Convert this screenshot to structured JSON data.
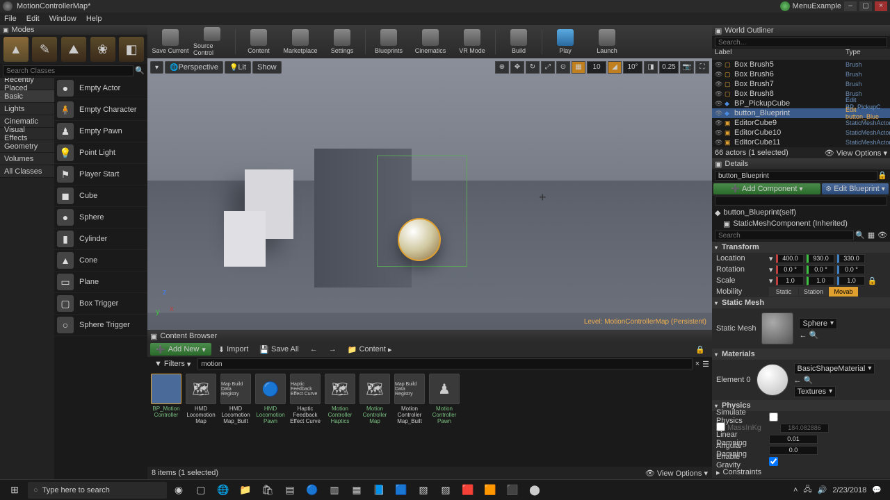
{
  "title": "MotionControllerMap*",
  "menu_example": "MenuExample",
  "menubar": [
    "File",
    "Edit",
    "Window",
    "Help"
  ],
  "modes": {
    "label": "Modes"
  },
  "search_classes_placeholder": "Search Classes",
  "categories": [
    "Recently Placed",
    "Basic",
    "Lights",
    "Cinematic",
    "Visual Effects",
    "Geometry",
    "Volumes",
    "All Classes"
  ],
  "place_items": [
    "Empty Actor",
    "Empty Character",
    "Empty Pawn",
    "Point Light",
    "Player Start",
    "Cube",
    "Sphere",
    "Cylinder",
    "Cone",
    "Plane",
    "Box Trigger",
    "Sphere Trigger"
  ],
  "toolbar": [
    {
      "id": "save",
      "label": "Save Current"
    },
    {
      "id": "source",
      "label": "Source Control"
    },
    {
      "id": "content",
      "label": "Content"
    },
    {
      "id": "market",
      "label": "Marketplace"
    },
    {
      "id": "settings",
      "label": "Settings"
    },
    {
      "id": "blueprints",
      "label": "Blueprints"
    },
    {
      "id": "cinematics",
      "label": "Cinematics"
    },
    {
      "id": "vr",
      "label": "VR Mode"
    },
    {
      "id": "build",
      "label": "Build"
    },
    {
      "id": "play",
      "label": "Play"
    },
    {
      "id": "launch",
      "label": "Launch"
    }
  ],
  "viewport": {
    "perspective": "Perspective",
    "lit": "Lit",
    "show": "Show",
    "snap_move": "10",
    "snap_rot": "10°",
    "snap_scale": "0.25",
    "level_label": "Level: MotionControllerMap (Persistent)"
  },
  "content_browser": {
    "header": "Content Browser",
    "add_new": "Add New",
    "import": "Import",
    "save_all": "Save All",
    "breadcrumb": "Content",
    "filters_label": "Filters",
    "filter_text": "motion",
    "items": [
      {
        "name": "BP_Motion Controller",
        "green": true
      },
      {
        "name": "HMD Locomotion Map",
        "green": false
      },
      {
        "name": "HMD Locomotion Map_Built",
        "green": false
      },
      {
        "name": "HMD Locomotion Pawn",
        "green": true
      },
      {
        "name": "Haptic Feedback Effect Curve",
        "green": false
      },
      {
        "name": "Motion Controller Haptics",
        "green": true
      },
      {
        "name": "Motion Controller Map",
        "green": true
      },
      {
        "name": "Motion Controller Map_Built",
        "green": false
      },
      {
        "name": "Motion Controller Pawn",
        "green": true
      }
    ],
    "status": "8 items (1 selected)",
    "view_options": "View Options"
  },
  "outliner": {
    "header": "World Outliner",
    "search_placeholder": "Search...",
    "col_label": "Label",
    "col_type": "Type",
    "rows": [
      {
        "name": "Box Brush5",
        "type": "Brush"
      },
      {
        "name": "Box Brush6",
        "type": "Brush"
      },
      {
        "name": "Box Brush7",
        "type": "Brush"
      },
      {
        "name": "Box Brush8",
        "type": "Brush"
      },
      {
        "name": "BP_PickupCube",
        "type": "Edit BP_PickupC"
      },
      {
        "name": "button_Blueprint",
        "type": "Edit button_Blue",
        "sel": true
      },
      {
        "name": "EditorCube9",
        "type": "StaticMeshActor"
      },
      {
        "name": "EditorCube10",
        "type": "StaticMeshActor"
      },
      {
        "name": "EditorCube11",
        "type": "StaticMeshActor"
      }
    ],
    "status": "66 actors (1 selected)",
    "view_options": "View Options"
  },
  "details": {
    "header": "Details",
    "actor_name": "button_Blueprint",
    "add_component": "Add Component",
    "edit_blueprint": "Edit Blueprint",
    "comp_self": "button_Blueprint(self)",
    "comp_mesh": "StaticMeshComponent (Inherited)",
    "search_placeholder": "Search",
    "transform": {
      "header": "Transform",
      "location": "Location",
      "rotation": "Rotation",
      "scale": "Scale",
      "mobility": "Mobility",
      "loc": [
        "400.0",
        "930.0",
        "330.0"
      ],
      "rot": [
        "0.0 °",
        "0.0 °",
        "0.0 °"
      ],
      "scl": [
        "1.0",
        "1.0",
        "1.0"
      ],
      "mob_static": "Static",
      "mob_station": "Station",
      "mob_mov": "Movab"
    },
    "static_mesh": {
      "header": "Static Mesh",
      "label": "Static Mesh",
      "value": "Sphere"
    },
    "materials": {
      "header": "Materials",
      "label": "Element 0",
      "value": "BasicShapeMaterial",
      "textures": "Textures"
    },
    "physics": {
      "header": "Physics",
      "simulate": "Simulate Physics",
      "mass": "MassInKg",
      "mass_val": "184.082886",
      "lin_damp": "Linear Damping",
      "lin_val": "0.01",
      "ang_damp": "Angular Damping",
      "ang_val": "0.0",
      "gravity": "Enable Gravity",
      "constraints": "Constraints"
    }
  },
  "taskbar": {
    "search_placeholder": "Type here to search",
    "time": "2/23/2018"
  }
}
